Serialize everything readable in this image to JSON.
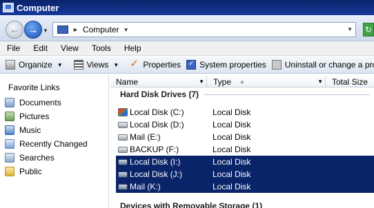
{
  "window": {
    "title": "Computer"
  },
  "address": {
    "crumb": "Computer"
  },
  "menu": {
    "items": [
      "File",
      "Edit",
      "View",
      "Tools",
      "Help"
    ]
  },
  "toolbar": {
    "organize": "Organize",
    "views": "Views",
    "properties": "Properties",
    "system_properties": "System properties",
    "uninstall": "Uninstall or change a progra"
  },
  "sidebar": {
    "heading": "Favorite Links",
    "items": [
      {
        "label": "Documents",
        "icon": "documents-icon"
      },
      {
        "label": "Pictures",
        "icon": "pictures-icon"
      },
      {
        "label": "Music",
        "icon": "music-icon"
      },
      {
        "label": "Recently Changed",
        "icon": "recently-changed-icon"
      },
      {
        "label": "Searches",
        "icon": "searches-icon"
      },
      {
        "label": "Public",
        "icon": "public-folder-icon"
      }
    ]
  },
  "columns": {
    "name": "Name",
    "type": "Type",
    "total_size": "Total Size"
  },
  "groups": {
    "hard_disks": "Hard Disk Drives (7)",
    "removable": "Devices with Removable Storage (1)"
  },
  "drives": [
    {
      "name": "Local Disk (C:)",
      "type": "Local Disk",
      "selected": false
    },
    {
      "name": "Local Disk (D:)",
      "type": "Local Disk",
      "selected": false
    },
    {
      "name": "Mail (E:)",
      "type": "Local Disk",
      "selected": false
    },
    {
      "name": "BACKUP (F:)",
      "type": "Local Disk",
      "selected": false
    },
    {
      "name": "Local Disk (I:)",
      "type": "Local Disk",
      "selected": true
    },
    {
      "name": "Local Disk (J:)",
      "type": "Local Disk",
      "selected": true
    },
    {
      "name": "Mail (K:)",
      "type": "Local Disk",
      "selected": true
    }
  ],
  "colors": {
    "selection": "#0a246a",
    "titlebar": "#0a246a"
  }
}
